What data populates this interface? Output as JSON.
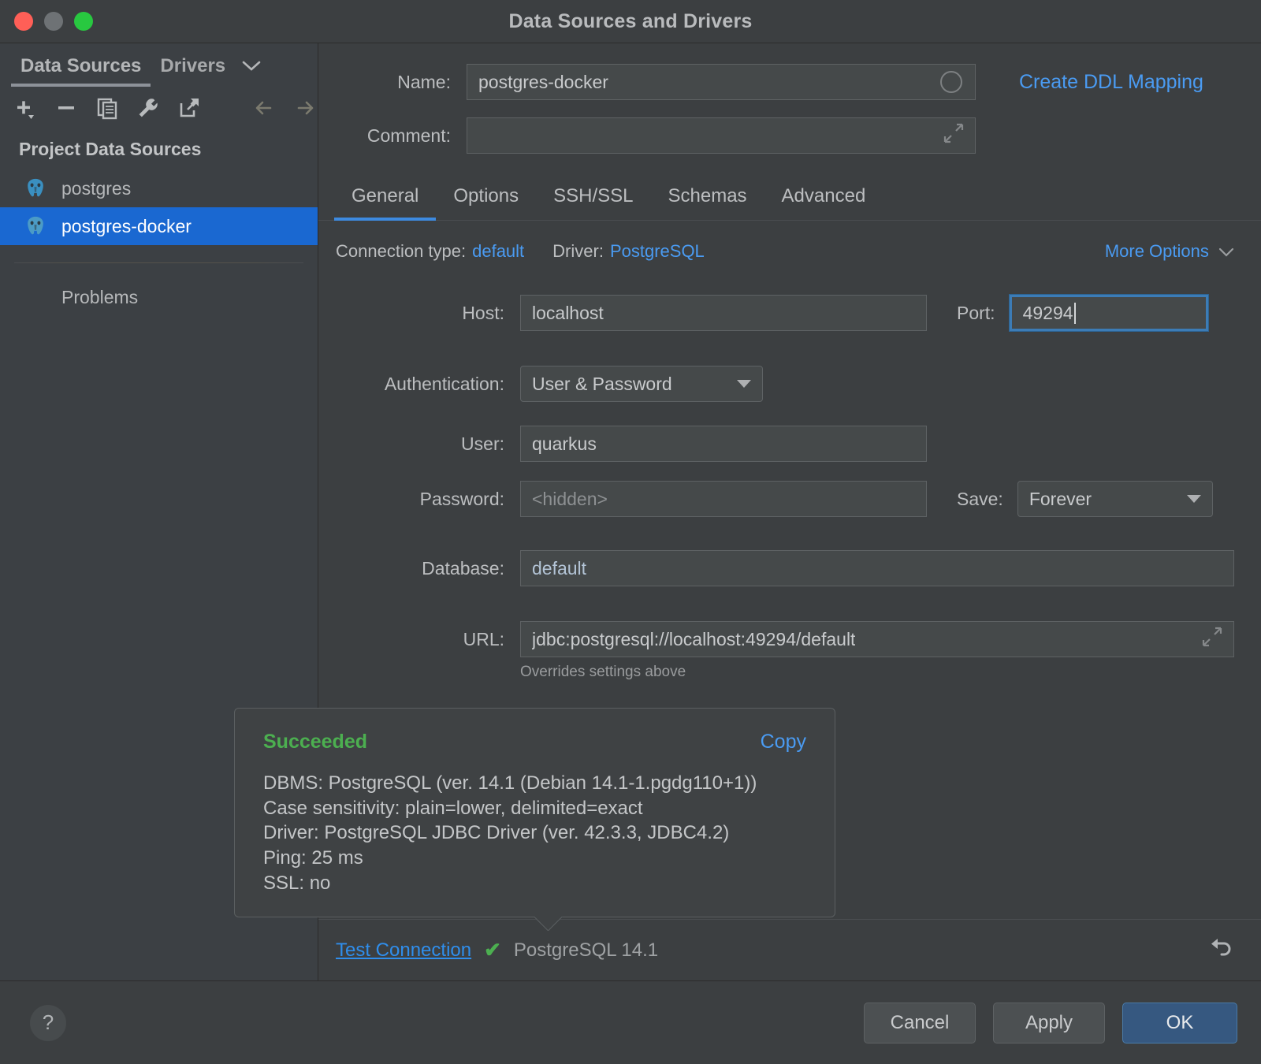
{
  "window": {
    "title": "Data Sources and Drivers",
    "traffic_lights": [
      "close",
      "minimize",
      "zoom"
    ]
  },
  "sidebar": {
    "tabs": [
      {
        "label": "Data Sources",
        "active": true
      },
      {
        "label": "Drivers",
        "active": false
      }
    ],
    "chevron_icon": "chevron-down-icon",
    "toolbar_icons": [
      "add-icon",
      "remove-icon",
      "copy-icon",
      "wrench-icon",
      "export-icon",
      "back-arrow-icon",
      "forward-arrow-icon"
    ],
    "section_title": "Project Data Sources",
    "items": [
      {
        "label": "postgres",
        "icon": "postgres-elephant-icon",
        "selected": false
      },
      {
        "label": "postgres-docker",
        "icon": "postgres-elephant-icon",
        "selected": true
      }
    ],
    "problems_label": "Problems"
  },
  "form": {
    "name_label": "Name:",
    "name_value": "postgres-docker",
    "comment_label": "Comment:",
    "comment_value": "",
    "create_ddl_link": "Create DDL Mapping"
  },
  "tabs": [
    {
      "label": "General",
      "active": true
    },
    {
      "label": "Options",
      "active": false
    },
    {
      "label": "SSH/SSL",
      "active": false
    },
    {
      "label": "Schemas",
      "active": false
    },
    {
      "label": "Advanced",
      "active": false
    }
  ],
  "connection": {
    "type_label": "Connection type:",
    "type_value": "default",
    "driver_label": "Driver:",
    "driver_value": "PostgreSQL",
    "more_options": "More Options"
  },
  "fields": {
    "host_label": "Host:",
    "host_value": "localhost",
    "port_label": "Port:",
    "port_value": "49294",
    "auth_label": "Authentication:",
    "auth_value": "User & Password",
    "user_label": "User:",
    "user_value": "quarkus",
    "password_label": "Password:",
    "password_placeholder": "<hidden>",
    "save_label": "Save:",
    "save_value": "Forever",
    "database_label": "Database:",
    "database_value": "default",
    "url_label": "URL:",
    "url_value": "jdbc:postgresql://localhost:49294/default",
    "url_hint": "Overrides settings above"
  },
  "popup": {
    "status": "Succeeded",
    "copy_label": "Copy",
    "lines": [
      "DBMS: PostgreSQL (ver. 14.1 (Debian 14.1-1.pgdg110+1))",
      "Case sensitivity: plain=lower, delimited=exact",
      "Driver: PostgreSQL JDBC Driver (ver. 42.3.3, JDBC4.2)",
      "Ping: 25 ms",
      "SSL: no"
    ]
  },
  "test_bar": {
    "link_label": "Test Connection",
    "check_icon": "check-icon",
    "version_text": "PostgreSQL 14.1",
    "reset_icon": "reset-icon"
  },
  "footer": {
    "help_label": "?",
    "cancel_label": "Cancel",
    "apply_label": "Apply",
    "ok_label": "OK"
  },
  "colors": {
    "accent_blue": "#4a9bf2",
    "selection_blue": "#1a68d1",
    "primary_button": "#365880",
    "success_green": "#4caf50",
    "window_bg": "#3c3f41",
    "sidebar_bg": "#3c4044",
    "field_bg": "#45494a",
    "focus_border": "#3c7cb6"
  }
}
